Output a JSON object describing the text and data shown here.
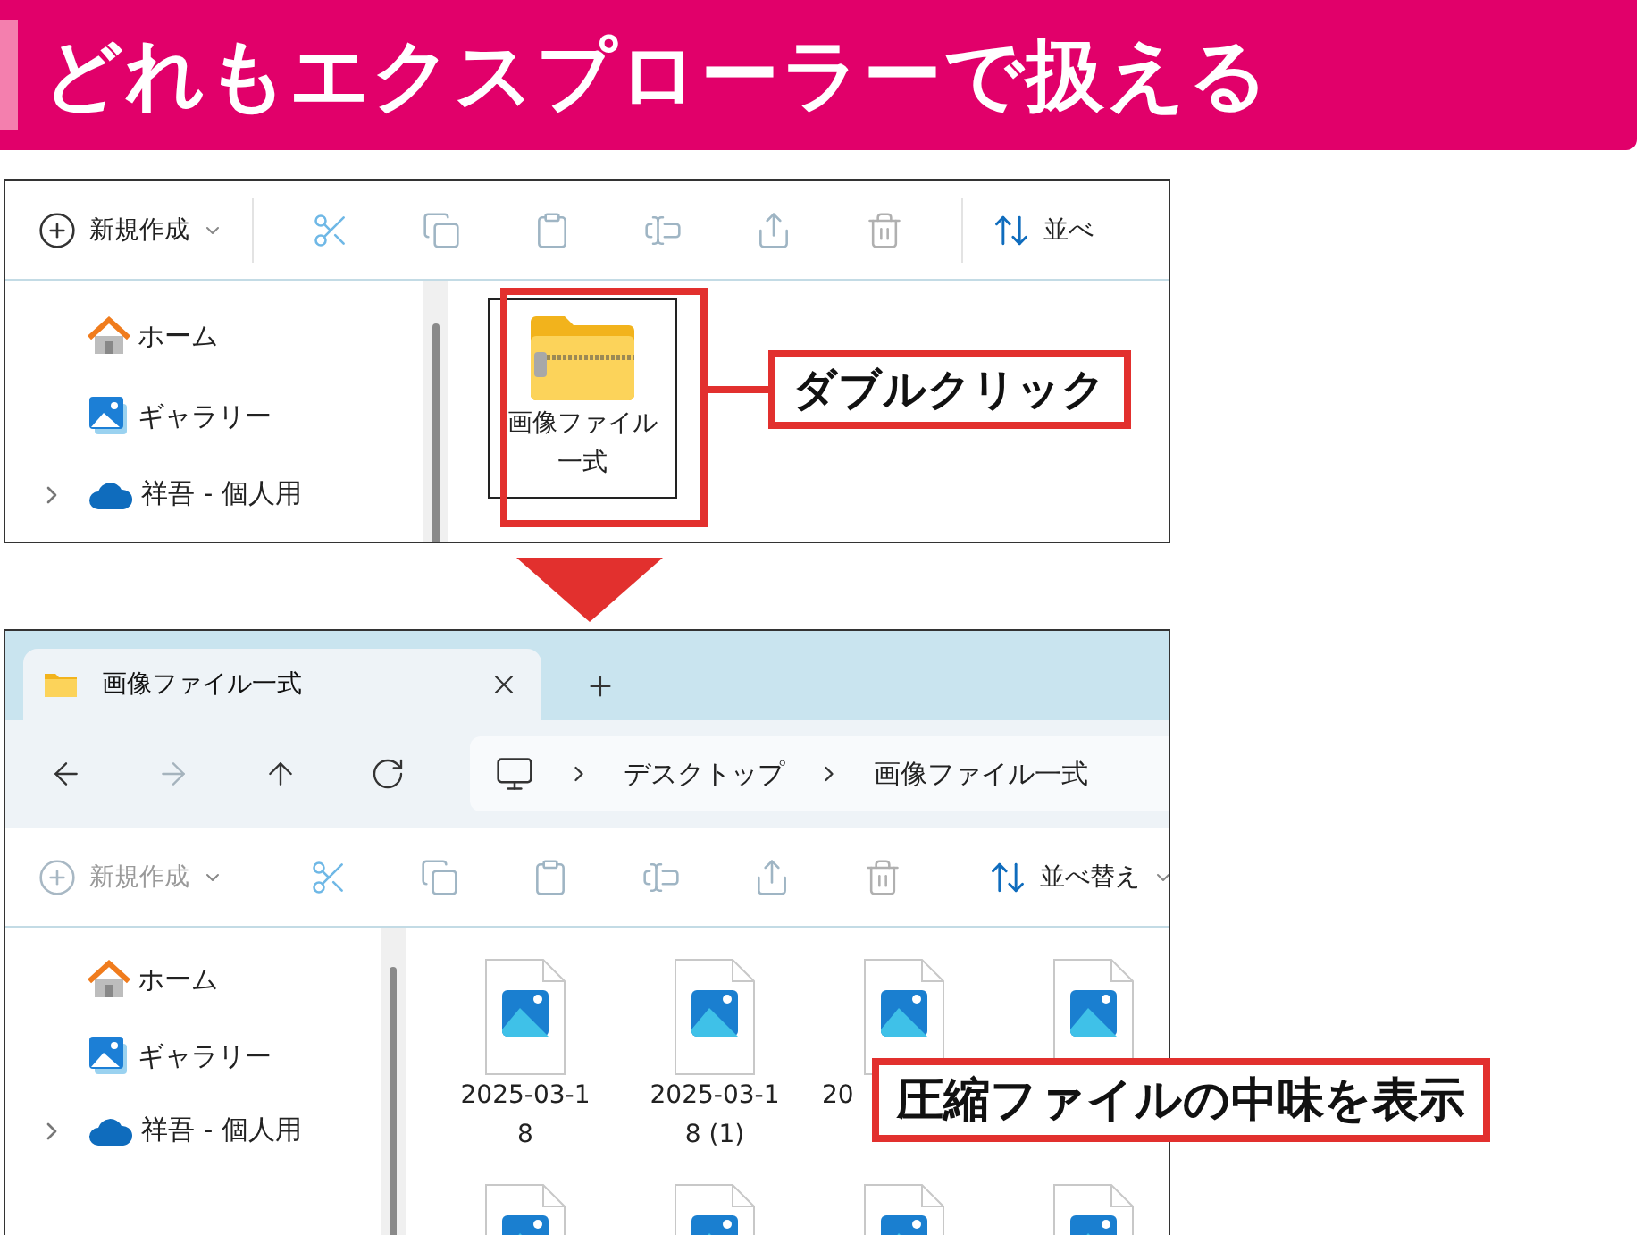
{
  "banner": {
    "title": "どれもエクスプローラーで扱える"
  },
  "before": {
    "toolbar": {
      "new_button": {
        "label": "新規作成",
        "disabled": false
      },
      "sort_button": {
        "label": "並べ",
        "has_menu": false
      }
    },
    "sidebar": {
      "items": [
        {
          "kind": "home",
          "label": "ホーム",
          "expandable": false
        },
        {
          "kind": "gallery",
          "label": "ギャラリー",
          "expandable": false
        },
        {
          "kind": "cloud",
          "label": "祥吾 - 個人用",
          "expandable": true
        }
      ]
    },
    "files": [
      {
        "kind": "zip-folder",
        "label_lines": [
          "画像ファイル",
          "一式"
        ],
        "truncated": false,
        "selected": true
      }
    ],
    "callout": "ダブルクリック"
  },
  "after": {
    "tab": {
      "title": "画像ファイル一式"
    },
    "nav": [
      {
        "kind": "back",
        "disabled": false
      },
      {
        "kind": "forward",
        "disabled": true
      },
      {
        "kind": "up",
        "disabled": false
      },
      {
        "kind": "refresh",
        "disabled": false
      }
    ],
    "address": [
      "デスクトップ",
      "画像ファイル一式"
    ],
    "toolbar": {
      "new_button": {
        "label": "新規作成",
        "disabled": true
      },
      "sort_button": {
        "label": "並べ替え",
        "has_menu": true
      }
    },
    "sidebar": {
      "items": [
        {
          "kind": "home",
          "label": "ホーム",
          "expandable": false
        },
        {
          "kind": "gallery",
          "label": "ギャラリー",
          "expandable": false
        },
        {
          "kind": "cloud",
          "label": "祥吾 - 個人用",
          "expandable": true
        }
      ]
    },
    "files": [
      {
        "kind": "image",
        "label_lines": [
          "2025-03-1",
          "8"
        ],
        "truncated": false,
        "selected": false
      },
      {
        "kind": "image",
        "label_lines": [
          "2025-03-1",
          "8 (1)"
        ],
        "truncated": false,
        "selected": false
      },
      {
        "kind": "image",
        "label_lines": [
          "20"
        ],
        "truncated": true,
        "selected": false
      },
      {
        "kind": "image",
        "selected": false
      },
      {
        "kind": "image",
        "selected": false
      },
      {
        "kind": "image",
        "selected": false
      },
      {
        "kind": "image",
        "selected": false
      },
      {
        "kind": "image",
        "selected": false
      }
    ],
    "callout": "圧縮ファイルの中味を表示"
  }
}
